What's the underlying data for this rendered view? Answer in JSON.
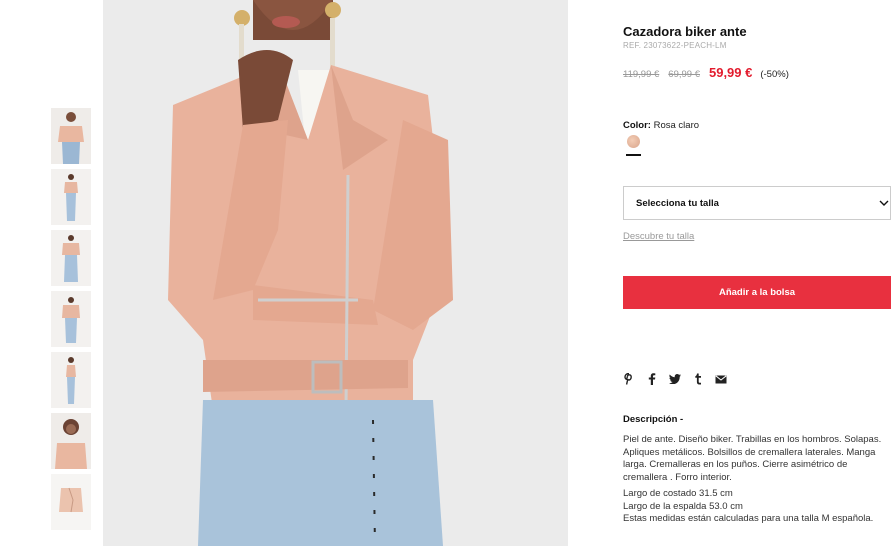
{
  "product": {
    "title": "Cazadora biker ante",
    "ref": "REF. 23073622-PEACH-LM",
    "old_price_1": "119,99 €",
    "old_price_2": "69,99 €",
    "price": "59,99 €",
    "discount": "(-50%)"
  },
  "color": {
    "label": "Color:",
    "value": "Rosa claro",
    "swatch_color": "#e8b9a0"
  },
  "size": {
    "select_label": "Selecciona tu talla",
    "guide_link": "Descubre tu talla"
  },
  "actions": {
    "add_to_bag": "Añadir a la bolsa",
    "accent_color": "#e8303f"
  },
  "share_icons": [
    "pinterest-icon",
    "facebook-icon",
    "twitter-icon",
    "tumblr-icon",
    "email-icon"
  ],
  "description": {
    "title": "Descripción -",
    "lines_1": [
      "Piel de ante. Diseño biker. Trabillas en los hombros. Solapas.",
      "Apliques metálicos. Bolsillos de cremallera laterales. Manga",
      "larga. Cremalleras en los puños. Cierre asimétrico de",
      "cremallera . Forro interior."
    ],
    "lines_2": [
      "Largo de costado 31.5 cm",
      "Largo de la espalda 53.0 cm",
      "Estas medidas están calculadas para una talla M española."
    ]
  },
  "gallery": {
    "thumbnail_count": 7
  }
}
